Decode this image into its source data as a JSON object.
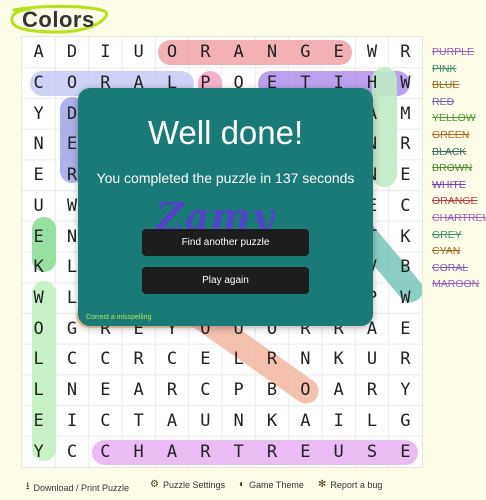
{
  "title": "Colors",
  "colors": {
    "page_bg": "#fdfde9",
    "modal_bg": "#1a7b76",
    "button_bg": "#1d1d1d",
    "title_outline": "#b6e21c",
    "misspell_link": "#b5e35a",
    "logo": "#5a3cd6"
  },
  "grid": {
    "rows": [
      "ADIUORANGEWR",
      "CORALPOETIHW",
      "YDBUINOORRAM",
      "NERCSSASGNNR",
      "EREOLBRNOANE",
      "UWEDOCLOVAEC",
      "ENROOLUMYTTK",
      "KLWYRCAEWAVB",
      "WLANDEERAAPW",
      "OGREYOUORRAE",
      "LCCRCELRNKUR",
      "LNEARCPBOARY",
      "EICTAUNKAILG",
      "YCCHARTREUSE"
    ]
  },
  "words": [
    {
      "text": "PURPLE",
      "color": "#9b5fc0"
    },
    {
      "text": "PINK",
      "color": "#3d8f6a"
    },
    {
      "text": "BLUE",
      "color": "#a06a22"
    },
    {
      "text": "RED",
      "color": "#7a5fc0"
    },
    {
      "text": "YELLOW",
      "color": "#4f9b2e"
    },
    {
      "text": "GREEN",
      "color": "#b06a22"
    },
    {
      "text": "BLACK",
      "color": "#3a6a5a"
    },
    {
      "text": "BROWN",
      "color": "#4f8b2e"
    },
    {
      "text": "WHITE",
      "color": "#7a3fb0"
    },
    {
      "text": "ORANGE",
      "color": "#b04040"
    },
    {
      "text": "CHARTREUSE",
      "color": "#9b5fc0"
    },
    {
      "text": "GREY",
      "color": "#3d8f6a"
    },
    {
      "text": "CYAN",
      "color": "#a06a22"
    },
    {
      "text": "CORAL",
      "color": "#7a5fc0"
    },
    {
      "text": "MAROON",
      "color": "#9b5fc0"
    }
  ],
  "modal": {
    "title": "Well done!",
    "subtitle": "You completed the puzzle in 137 seconds",
    "logo_text": "Zamy",
    "find_button": "Find another puzzle",
    "again_button": "Play again",
    "misspell_link": "Correct a misspelling"
  },
  "footer": {
    "download": {
      "label": "Download / Print Puzzle",
      "icon": "download-icon"
    },
    "settings": {
      "label": "Puzzle Settings",
      "icon": "gear-icon"
    },
    "theme": {
      "label": "Game Theme",
      "icon": "contrast-icon"
    },
    "bug": {
      "label": "Report a bug",
      "icon": "bug-icon"
    }
  }
}
